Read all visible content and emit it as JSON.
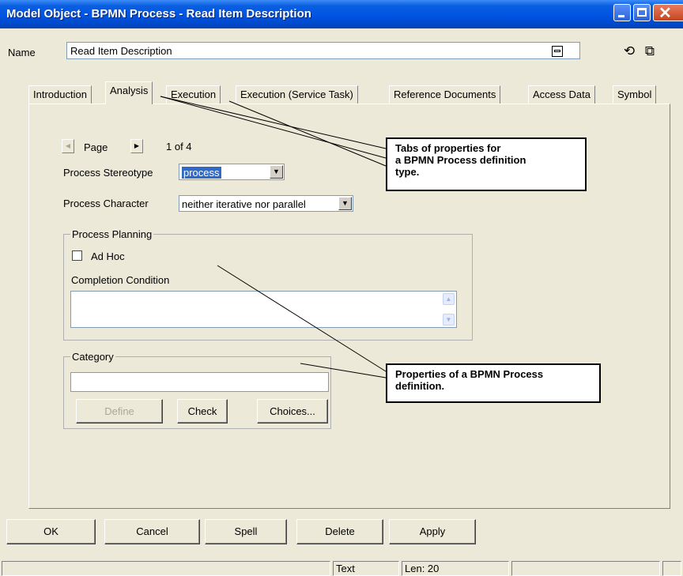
{
  "window": {
    "title": "Model Object - BPMN Process - Read Item Description",
    "controls": [
      "minimize-icon",
      "maximize-icon",
      "close-icon"
    ]
  },
  "name_row": {
    "label": "Name",
    "value": "Read Item Description",
    "icons": [
      "history-icon",
      "open-window-icon"
    ]
  },
  "tabs": [
    {
      "label": "Introduction",
      "active": false
    },
    {
      "label": "Analysis",
      "active": true
    },
    {
      "label": "Execution",
      "active": false
    },
    {
      "label": "Execution (Service Task)",
      "active": false
    },
    {
      "label": "Reference Documents",
      "active": false
    },
    {
      "label": "Access Data",
      "active": false
    },
    {
      "label": "Symbol",
      "active": false
    }
  ],
  "pager": {
    "label": "Page",
    "status": "1 of 4"
  },
  "fields": {
    "stereotype_label": "Process Stereotype",
    "stereotype_value": "process",
    "character_label": "Process Character",
    "character_value": "neither iterative nor parallel"
  },
  "planning": {
    "title": "Process Planning",
    "adhoc_label": "Ad Hoc",
    "adhoc_checked": false,
    "completion_label": "Completion Condition",
    "completion_value": ""
  },
  "category": {
    "title": "Category",
    "value": "",
    "define_label": "Define",
    "check_label": "Check",
    "choices_label": "Choices..."
  },
  "buttons": {
    "ok": "OK",
    "cancel": "Cancel",
    "spell": "Spell",
    "delete": "Delete",
    "apply": "Apply"
  },
  "status": {
    "text_label": "Text",
    "len_label": "Len: 20"
  },
  "callouts": {
    "tabs_note": [
      "Tabs of properties for",
      "a BPMN Process definition",
      "type."
    ],
    "props_note": [
      "Properties of a BPMN Process",
      "definition."
    ]
  },
  "colors": {
    "title_bar": "#0054e3",
    "dialog_bg": "#ece9d8",
    "selection": "#316ac5"
  }
}
